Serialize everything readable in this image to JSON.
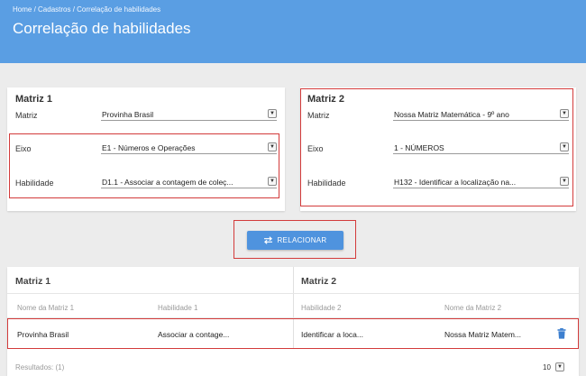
{
  "breadcrumb": [
    "Home",
    "Cadastros",
    "Correlação de habilidades"
  ],
  "breadcrumb_sep": " / ",
  "page_title": "Correlação de habilidades",
  "matriz1": {
    "title": "Matriz 1",
    "fields": [
      {
        "label": "Matriz",
        "value": "Provinha Brasil"
      },
      {
        "label": "Eixo",
        "value": "E1 - Números e Operações"
      },
      {
        "label": "Habilidade",
        "value": "D1.1 - Associar a contagem de coleç..."
      }
    ]
  },
  "matriz2": {
    "title": "Matriz 2",
    "fields": [
      {
        "label": "Matriz",
        "value": "Nossa Matriz Matemática - 9º ano"
      },
      {
        "label": "Eixo",
        "value": "1 - NÚMEROS"
      },
      {
        "label": "Habilidade",
        "value": "H132 - Identificar a localização na..."
      }
    ]
  },
  "relacionar_label": "RELACIONAR",
  "table": {
    "group1": "Matriz 1",
    "group2": "Matriz 2",
    "columns": [
      "Nome da Matriz 1",
      "Habilidade 1",
      "Habilidade 2",
      "Nome da Matriz 2"
    ],
    "rows": [
      [
        "Provinha Brasil",
        "Associar a contage...",
        "Identificar a loca...",
        "Nossa Matriz Matem..."
      ]
    ],
    "results": "Resultados: (1)",
    "page_size": "10"
  },
  "colors": {
    "header": "#5a9ee3",
    "button": "#4f93de",
    "highlight": "#d33b3b",
    "trash": "#3d7fcf"
  },
  "icons": {
    "relacionar": "swap-arrows-icon",
    "delete": "trash-icon",
    "select": "chevron-down-icon"
  }
}
